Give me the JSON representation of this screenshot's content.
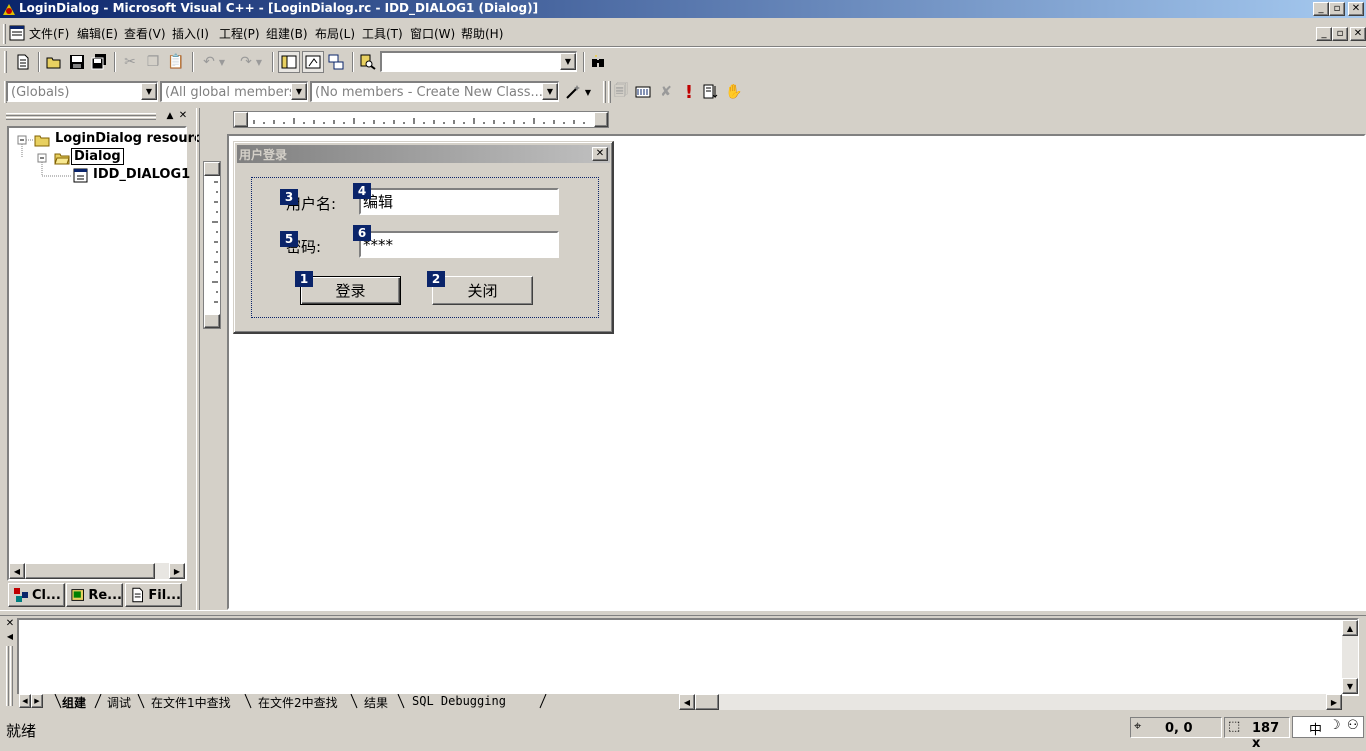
{
  "window": {
    "title": "LoginDialog - Microsoft Visual C++ - [LoginDialog.rc - IDD_DIALOG1 (Dialog)]",
    "minimize_glyph": "_",
    "restore_glyph": "▫",
    "close_glyph": "✕"
  },
  "menu": {
    "items": [
      "文件(F)",
      "编辑(E)",
      "查看(V)",
      "插入(I)",
      "工程(P)",
      "组建(B)",
      "布局(L)",
      "工具(T)",
      "窗口(W)",
      "帮助(H)"
    ]
  },
  "toolbar": {
    "find_combo_value": ""
  },
  "wizardbar": {
    "class_combo": "(Globals)",
    "filter_combo": "(All global members",
    "members_combo": "(No members - Create New Class...)"
  },
  "workspace": {
    "tree": {
      "root": "LoginDialog resources",
      "folder": "Dialog",
      "item": "IDD_DIALOG1"
    },
    "tabs": [
      "Cl...",
      "Re...",
      "Fil..."
    ]
  },
  "dialog": {
    "caption": "用户登录",
    "username_label": "用户名:",
    "username_value": "编辑",
    "password_label": "密码:",
    "password_value": "****",
    "login_button": "登录",
    "close_button": "关闭",
    "tab_orders": [
      "3",
      "4",
      "5",
      "6",
      "1",
      "2"
    ]
  },
  "output": {
    "tabs": [
      "组建",
      "调试",
      "在文件1中查找",
      "在文件2中查找",
      "结果",
      "SQL Debugging"
    ]
  },
  "statusbar": {
    "text": "就绪",
    "position": "0, 0",
    "size": "187 x",
    "ime": "中"
  },
  "colors": {
    "title_gradient_start": "#0a246a",
    "title_gradient_end": "#a6caf0",
    "face": "#d4d0c8",
    "tab_order_badge": "#0a246a"
  }
}
